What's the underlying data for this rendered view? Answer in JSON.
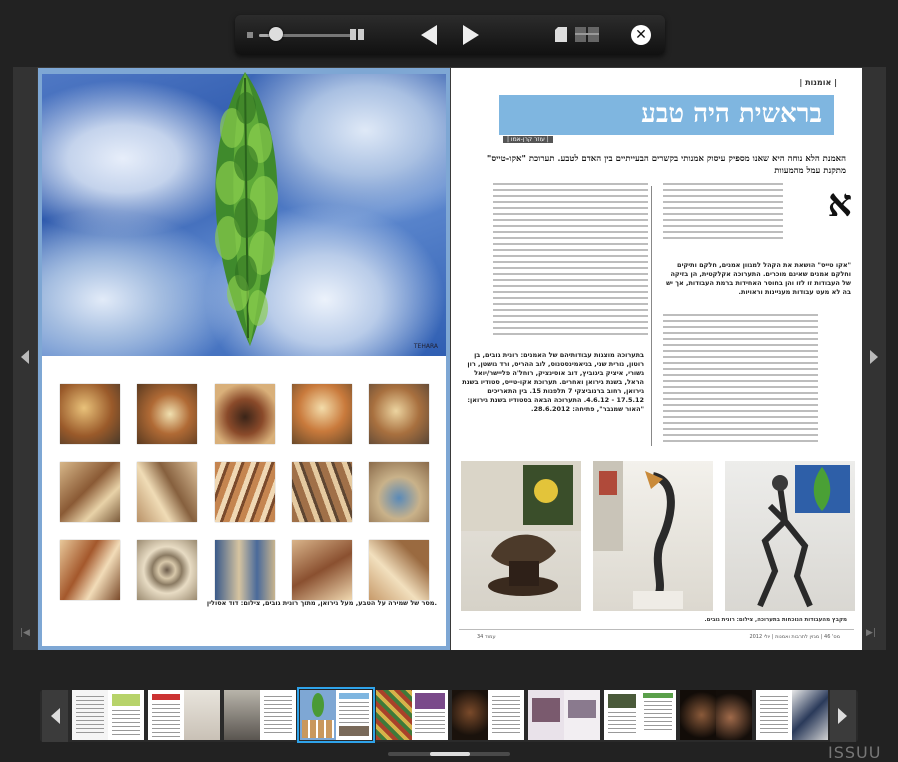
{
  "toolbar": {
    "zoom_level": 0.18,
    "close_symbol": "✕"
  },
  "icons": {
    "zoom": "zoom-slider-icon",
    "spread": "spread-view-icon",
    "prev": "previous-page-icon",
    "next": "next-page-icon",
    "single": "single-page-icon",
    "double": "double-page-icon",
    "close": "close-icon"
  },
  "left_page": {
    "art_signature": "TEHARA",
    "caption": "מסר של שמירה על הטבע, מעל גירואן, מתוך רונית גובים, צילום: דוד אסולין."
  },
  "right_page": {
    "section": "| אומנות |",
    "title": "בראשית היה טבע",
    "byline": "| עוזר קרן-אמו |",
    "subhead": "האמנת הלא נוחה היא שאנו מספיק עיסוק אמנותי בקשרים הבעייתיים בין האדם לטבע. תערוכת \"אקו-טייס\" מתקנת עמל מהמעוות",
    "drop_cap": "א",
    "col_heading": "\"אקו טייס\" הושאת את הקהל למגוון אמנים, חלקם ותיקים וחלקם אמנים שאינם מוכרים. התערוכה אקלקטית, הן בזיקה של העבודות זו לזו והן בחוסר האחידות ברמת העבודות, אך יש בה לא מעט עבודות מעניינות וראויות.",
    "info": "בתערוכה מוצגות עבודותיהם של האמנים: רונית גובים, בן רוטון, נורית שני, בניאמינסטנוס, לוב ההריס, ורד גושטן, רון גשורי, איציק ביגוביץ, דוב אוסינציק, רוחל'ה פליישר/יואל הראל, בשנת גירואן ואחרים. תערוכת אקו-טייס, סטודיו בשנת גירואן, רחוב ברנוביצקי 7 תלפנות 15. בין התאריכים 17.5.12 - 4.6.12. התערוכה הבאה בסטודיו בשנת גירואן: \"האור שמגבר\", פתיחה: 28.6.2012.",
    "caption": "מקבץ מהעבודות הנוכחות בתערוכה, צילום: רונית גובים.",
    "footer_left": "עמוד 34",
    "footer_right": "מס' 46 | מגזין לתרבות ואמנות | יולי 2012"
  },
  "strip": {
    "active_index": 3,
    "count": 10,
    "prev_label": "previous-thumbnails",
    "next_label": "next-thumbnails"
  },
  "brand": "ISSUU",
  "colors": {
    "accent": "#2fa3ea",
    "title_banner": "#7fb6e0",
    "page_frame": "#7ea7d4",
    "background": "#222222"
  }
}
